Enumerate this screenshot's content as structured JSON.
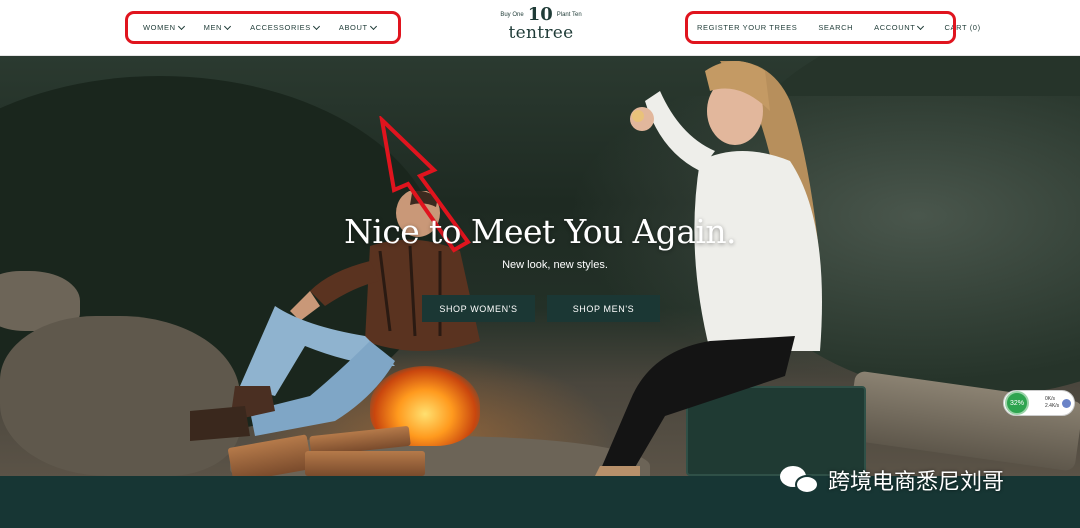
{
  "header": {
    "nav_left": [
      {
        "label": "WOMEN",
        "dropdown": true
      },
      {
        "label": "MEN",
        "dropdown": true
      },
      {
        "label": "ACCESSORIES",
        "dropdown": true
      },
      {
        "label": "ABOUT",
        "dropdown": true
      }
    ],
    "logo": {
      "buy_one": "Buy One",
      "ten": "10",
      "plant_ten": "Plant Ten",
      "wordmark": "tentree"
    },
    "nav_right": {
      "register": "REGISTER YOUR TREES",
      "search": "SEARCH",
      "account": "ACCOUNT",
      "cart": "CART (0)"
    }
  },
  "hero": {
    "title": "Nice to Meet You Again.",
    "subtitle": "New look, new styles.",
    "shop_women": "SHOP WOMEN'S",
    "shop_men": "SHOP MEN'S"
  },
  "speed_widget": {
    "percent": "32%",
    "line1": "0K/s",
    "line2": "2.4K/s"
  },
  "watermark": {
    "text": "跨境电商悉尼刘哥",
    "icon": "wechat-icon"
  },
  "colors": {
    "annotation_red": "#e0141e",
    "brand_green": "#1b3734",
    "band": "#173634"
  }
}
